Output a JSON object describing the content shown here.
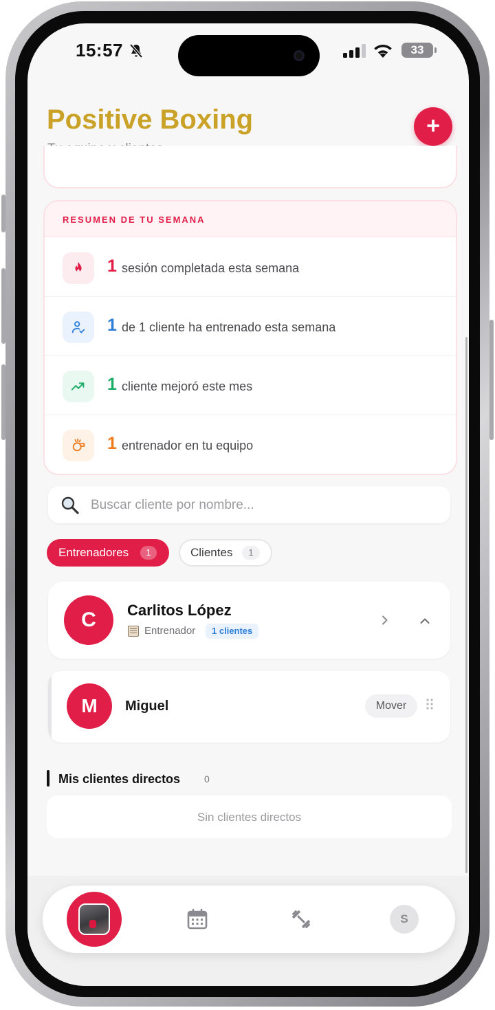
{
  "status_bar": {
    "time": "15:57",
    "battery": "33"
  },
  "header": {
    "title": "Positive Boxing",
    "subtitle": "Tu equipo y clientes",
    "add_label": "+"
  },
  "summary": {
    "title": "RESUMEN DE TU SEMANA",
    "rows": [
      {
        "number": "1",
        "text": "sesión completada esta semana",
        "color": "#e01e48",
        "icon": "flame-icon"
      },
      {
        "number": "1",
        "text": "de 1 cliente ha entrenado esta semana",
        "color": "#2f7fd8",
        "icon": "user-check-icon"
      },
      {
        "number": "1",
        "text": "cliente mejoró este mes",
        "color": "#1fae6a",
        "icon": "trending-up-icon"
      },
      {
        "number": "1",
        "text": "entrenador en tu equipo",
        "color": "#ef7a1a",
        "icon": "whistle-icon"
      }
    ]
  },
  "search": {
    "placeholder": "Buscar cliente por nombre...",
    "value": ""
  },
  "tabs": [
    {
      "label": "Entrenadores",
      "count": "1",
      "active": true
    },
    {
      "label": "Clientes",
      "count": "1",
      "active": false
    }
  ],
  "trainer": {
    "initial": "C",
    "name": "Carlitos López",
    "role": "Entrenador",
    "clients_badge": "1 clientes"
  },
  "client": {
    "initial": "M",
    "name": "Miguel",
    "move_label": "Mover"
  },
  "direct_clients": {
    "title": "Mis clientes directos",
    "count": "0",
    "empty": "Sin clientes directos"
  },
  "bottom_nav": {
    "profile_initial": "S",
    "items": [
      "home",
      "calendar",
      "workouts",
      "profile"
    ]
  },
  "colors": {
    "brand_gold": "#c9a227",
    "accent_red": "#e01e48"
  }
}
